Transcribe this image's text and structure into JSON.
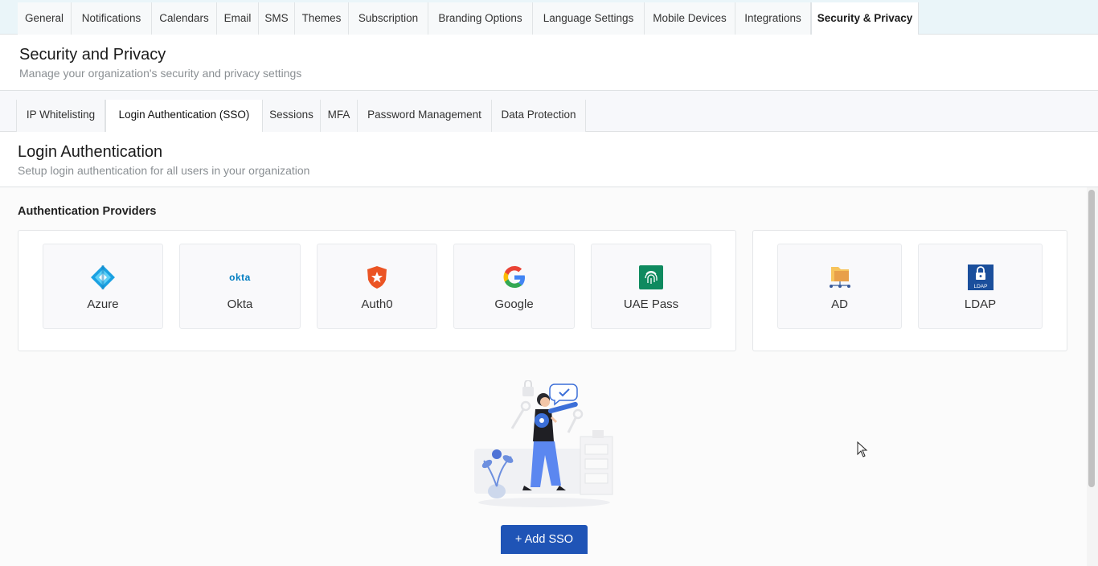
{
  "top_tabs": [
    "General",
    "Notifications",
    "Calendars",
    "Email",
    "SMS",
    "Themes",
    "Subscription",
    "Branding Options",
    "Language Settings",
    "Mobile Devices",
    "Integrations",
    "Security & Privacy"
  ],
  "page": {
    "title": "Security and Privacy",
    "subtitle": "Manage your organization's security and privacy settings"
  },
  "sub_tabs": [
    "IP Whitelisting",
    "Login Authentication (SSO)",
    "Sessions",
    "MFA",
    "Password Management",
    "Data Protection"
  ],
  "section": {
    "title": "Login Authentication",
    "subtitle": "Setup login authentication for all users in your organization"
  },
  "providers": {
    "heading": "Authentication Providers",
    "sso": [
      {
        "label": "Azure",
        "icon": "azure-icon"
      },
      {
        "label": "Okta",
        "icon": "okta-icon",
        "icon_text": "okta"
      },
      {
        "label": "Auth0",
        "icon": "auth0-icon"
      },
      {
        "label": "Google",
        "icon": "google-icon"
      },
      {
        "label": "UAE Pass",
        "icon": "uae-pass-icon"
      }
    ],
    "directory": [
      {
        "label": "AD",
        "icon": "active-directory-icon"
      },
      {
        "label": "LDAP",
        "icon": "ldap-icon",
        "icon_text": "LDAP"
      }
    ]
  },
  "actions": {
    "add_sso_label": "+ Add SSO"
  },
  "colors": {
    "primary_button": "#1f54b6",
    "azure": "#1ba1e2",
    "okta": "#007dc1",
    "auth0": "#eb5424",
    "uae_pass": "#0f8a5f",
    "ldap": "#1b4f9c"
  }
}
